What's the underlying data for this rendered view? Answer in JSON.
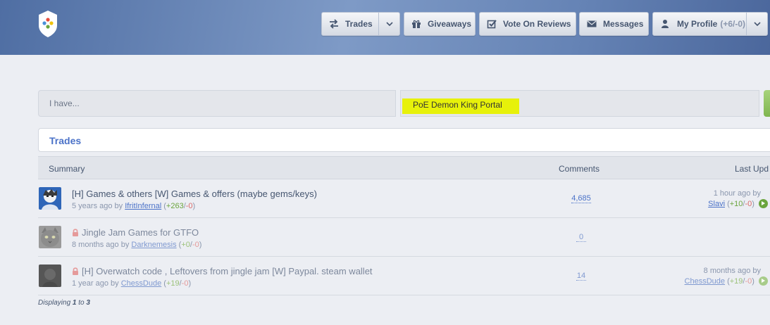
{
  "nav": {
    "trades": "Trades",
    "giveaways": "Giveaways",
    "vote_on_reviews": "Vote On Reviews",
    "messages": "Messages",
    "my_profile": "My Profile",
    "profile_rep": "(+6/-0)"
  },
  "search": {
    "have_placeholder": "I have...",
    "want_value": "PoE Demon King Portal"
  },
  "trades_title": "Trades",
  "table": {
    "col_summary": "Summary",
    "col_comments": "Comments",
    "col_last": "Last Upd"
  },
  "rows": [
    {
      "title": "[H] Games & others [W] Games & offers (maybe gems/keys)",
      "age": "5 years ago by",
      "user": "IfritInfernal",
      "rep_pos": "+263",
      "rep_neg": "-0",
      "comments": "4,685",
      "last_time": "1 hour ago by",
      "last_user": "Slavi",
      "last_pos": "+10",
      "last_neg": "-0",
      "locked": false
    },
    {
      "title": "Jingle Jam Games for GTFO",
      "age": "8 months ago by",
      "user": "Darknemesis",
      "rep_pos": "+0",
      "rep_neg": "-0",
      "comments": "0",
      "locked": true
    },
    {
      "title": "[H] Overwatch code , Leftovers from jingle jam [W] Paypal. steam wallet",
      "age": "1 year ago by",
      "user": "ChessDude",
      "rep_pos": "+19",
      "rep_neg": "-0",
      "comments": "14",
      "last_time": "8 months ago by",
      "last_user": "ChessDude",
      "last_pos": "+19",
      "last_neg": "-0",
      "locked": true
    }
  ],
  "footer": {
    "prefix": "Displaying",
    "from": "1",
    "to_word": "to",
    "to": "3"
  },
  "colors": {
    "header_blue": "#5a78ad",
    "link_blue": "#4b72c8",
    "positive": "#6ba53e",
    "negative": "#d96a6a",
    "highlight": "#e7f10a"
  },
  "icons": [
    "shield-logo-icon",
    "trades-arrows-icon",
    "gift-icon",
    "checkbox-icon",
    "envelope-icon",
    "user-icon",
    "chevron-down-icon",
    "lock-icon",
    "go-arrow-icon"
  ]
}
